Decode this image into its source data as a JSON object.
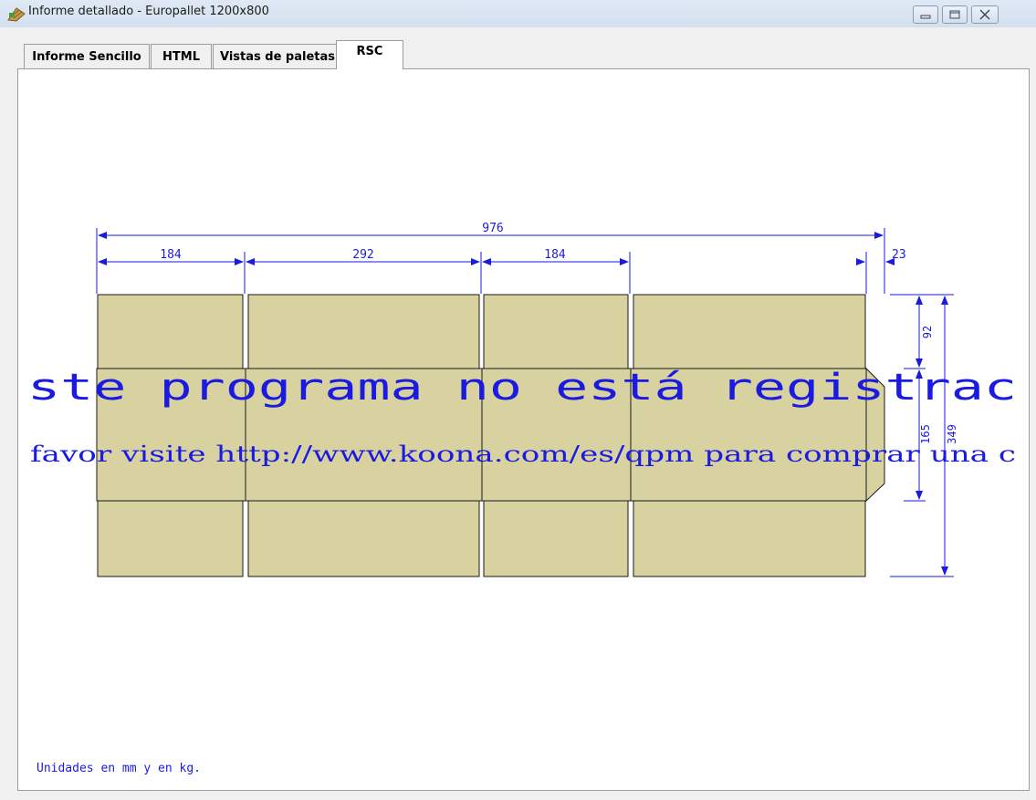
{
  "window": {
    "title": "Informe detallado - Europallet 1200x800",
    "buttons": [
      "minimize-icon",
      "restore-icon",
      "close-icon"
    ]
  },
  "tabs": [
    {
      "label": "Informe Sencillo",
      "active": false
    },
    {
      "label": "HTML",
      "active": false
    },
    {
      "label": "Vistas de paletas",
      "active": false
    },
    {
      "label": "RSC",
      "active": true
    }
  ],
  "drawing": {
    "dimensions": {
      "total_length": "976",
      "panel_1": "184",
      "panel_2": "292",
      "panel_3": "184",
      "glue_flap": "23",
      "flap_height": "92",
      "body_height": "165",
      "total_height": "349"
    },
    "watermark_line1": "ste programa no está registrac",
    "watermark_line2": "favor visite http://www.koona.com/es/qpm para comprar una c",
    "colors": {
      "board_fill": "#d8d2a0",
      "dimension": "#1a1ae0",
      "outline": "#1a1a1a"
    }
  },
  "footer": {
    "units_note": "Unidades en mm y en kg."
  }
}
